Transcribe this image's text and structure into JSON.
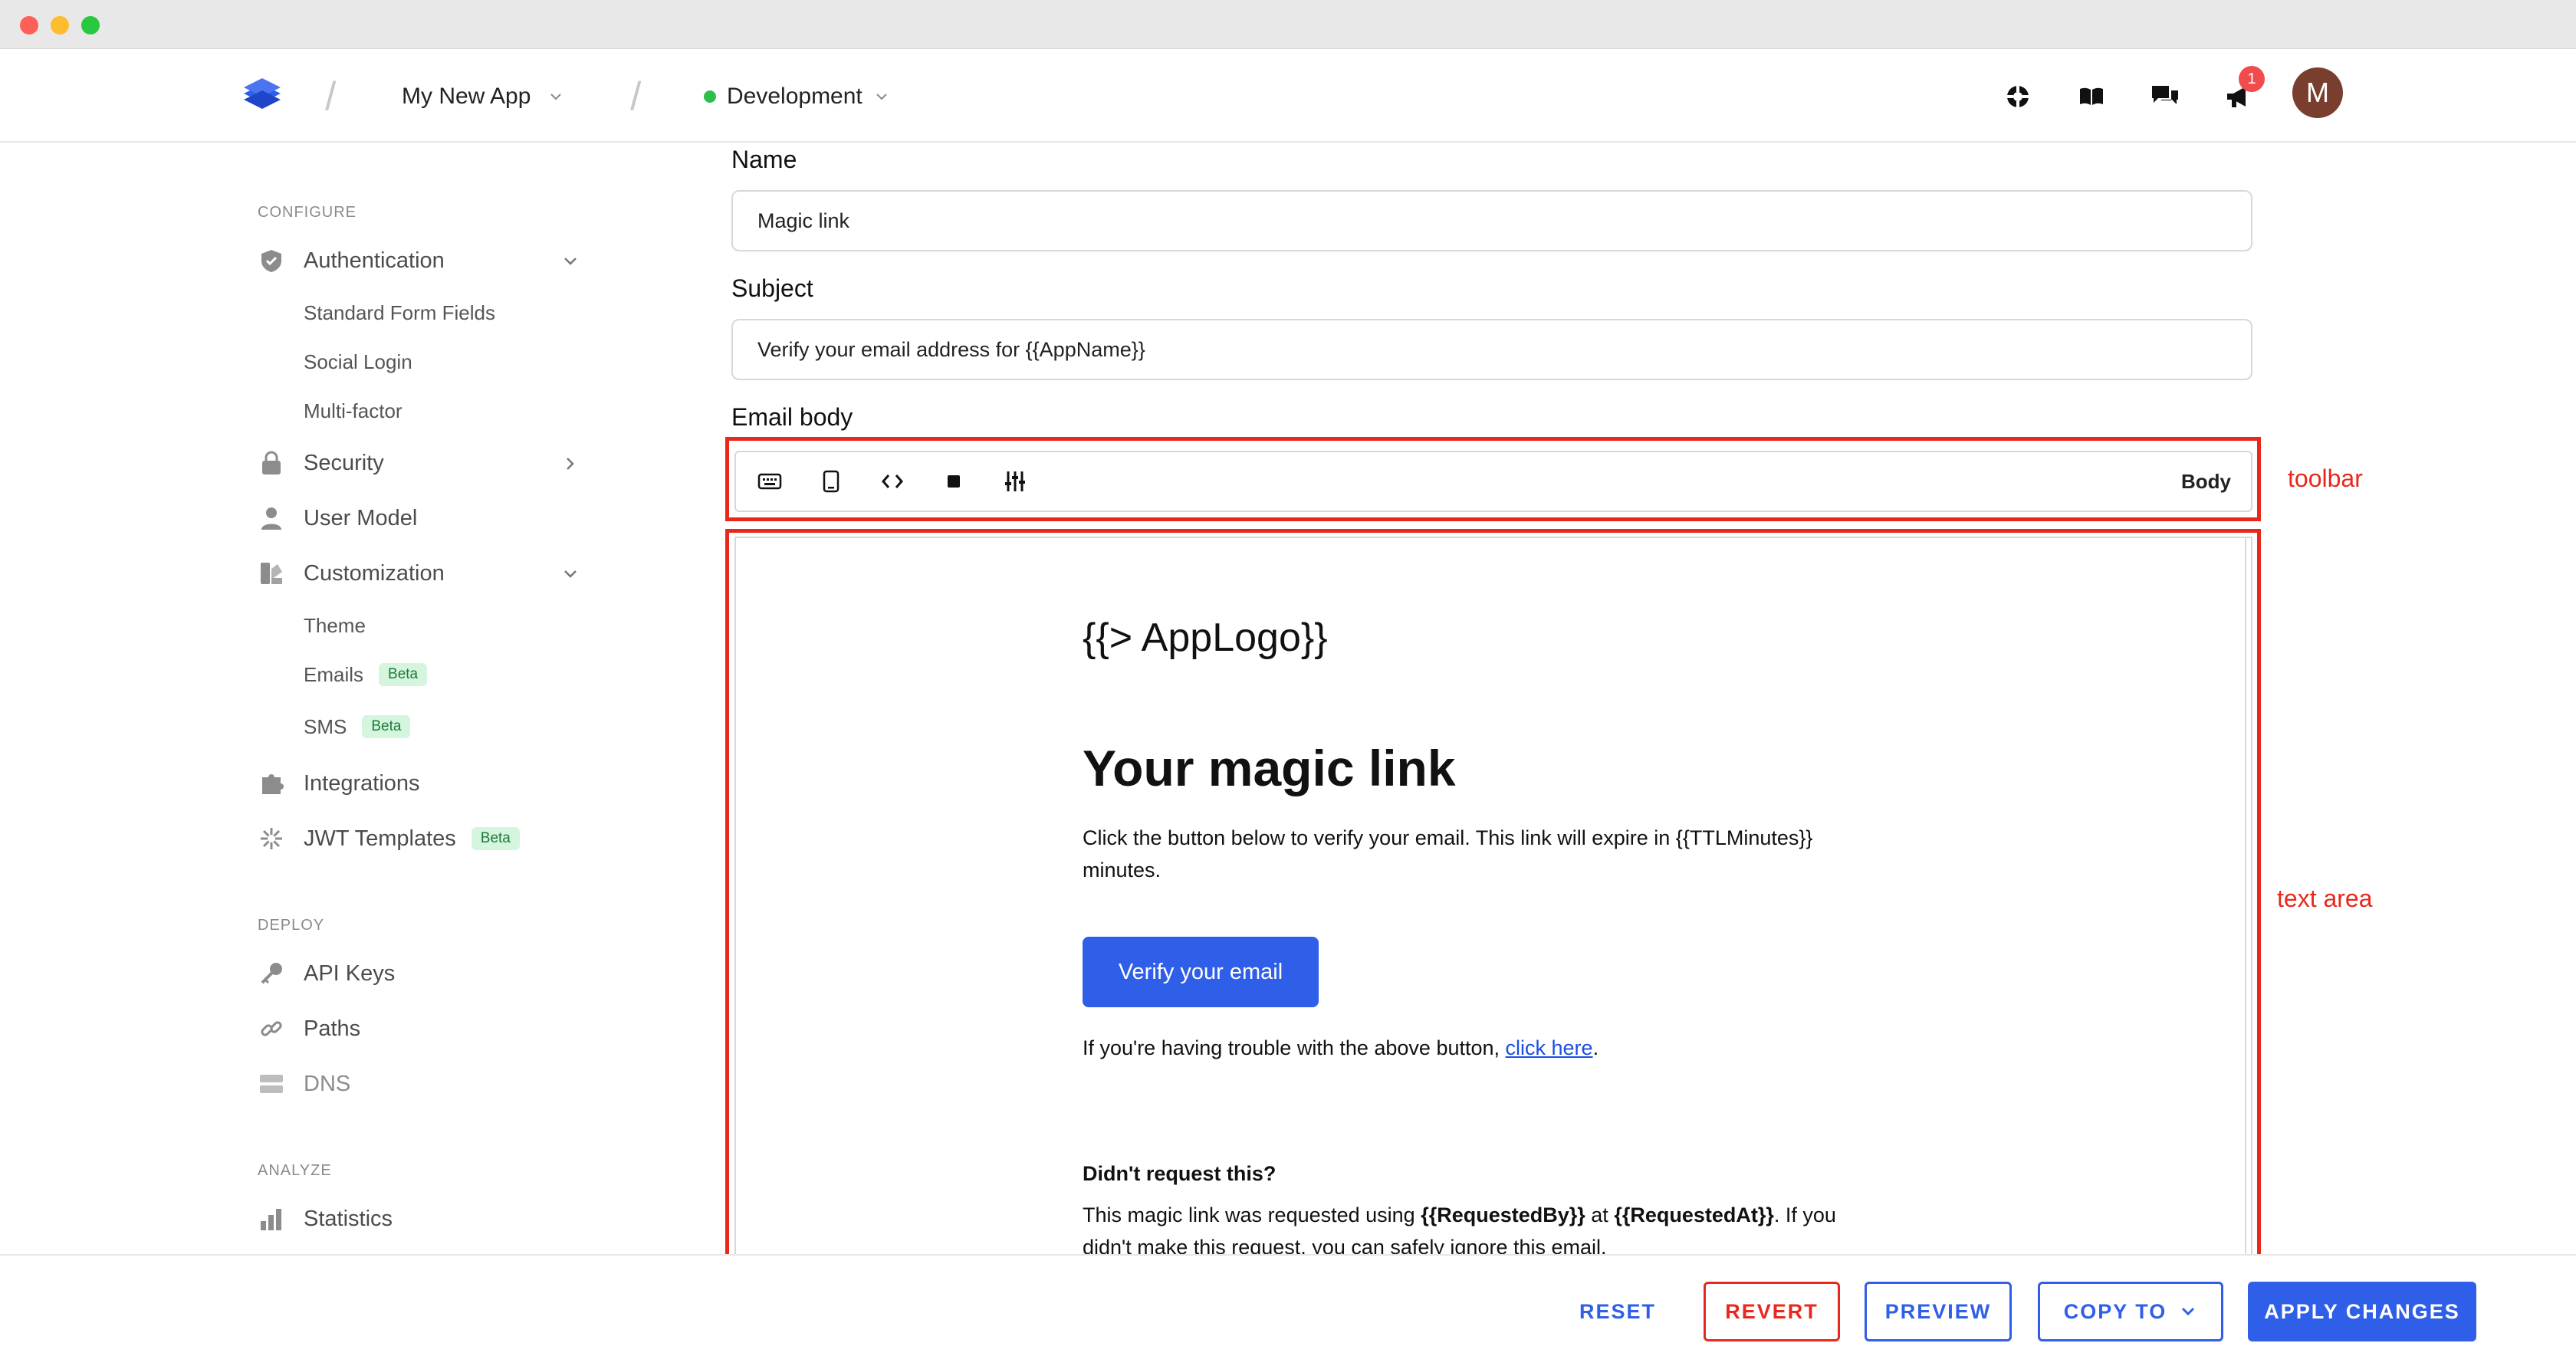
{
  "topnav": {
    "app_name": "My New App",
    "environment": "Development",
    "notification_count": "1",
    "avatar_initial": "M",
    "icons": [
      "support-icon",
      "docs-icon",
      "chat-icon",
      "announcements-icon"
    ]
  },
  "sidebar": {
    "configure_label": "CONFIGURE",
    "deploy_label": "DEPLOY",
    "analyze_label": "ANALYZE",
    "authentication": "Authentication",
    "standard_form_fields": "Standard Form Fields",
    "social_login": "Social Login",
    "multi_factor": "Multi-factor",
    "security": "Security",
    "user_model": "User Model",
    "customization": "Customization",
    "theme": "Theme",
    "emails": "Emails",
    "sms": "SMS",
    "integrations": "Integrations",
    "jwt_templates": "JWT Templates",
    "beta": "Beta",
    "api_keys": "API Keys",
    "paths": "Paths",
    "dns": "DNS",
    "statistics": "Statistics"
  },
  "form": {
    "name_label": "Name",
    "name_value": "Magic link",
    "subject_label": "Subject",
    "subject_value": "Verify your email address for {{AppName}}",
    "body_label": "Email body",
    "toolbar_mode": "Body"
  },
  "email": {
    "logo": "{{> AppLogo}}",
    "heading": "Your magic link",
    "intro": "Click the button below to verify your email. This link will expire in {{TTLMinutes}} minutes.",
    "button": "Verify your email",
    "trouble_prefix": "If you're having trouble with the above button, ",
    "trouble_link": "click here",
    "trouble_suffix": ".",
    "subhead": "Didn't request this?",
    "footer_1": "This magic link was requested using ",
    "footer_requested_by": "{{RequestedBy}}",
    "footer_2": " at ",
    "footer_requested_at": "{{RequestedAt}}",
    "footer_3": ". If you didn't make this request, you can safely ignore this email."
  },
  "annotations": {
    "toolbar": "toolbar",
    "text_area": "text area"
  },
  "actions": {
    "reset": "RESET",
    "revert": "REVERT",
    "preview": "PREVIEW",
    "copy_to": "COPY TO",
    "apply": "APPLY CHANGES"
  },
  "colors": {
    "accent": "#2f5ee8",
    "danger": "#e8281c",
    "beta_bg": "#d6f5df",
    "env_dot": "#2bbf4b"
  }
}
